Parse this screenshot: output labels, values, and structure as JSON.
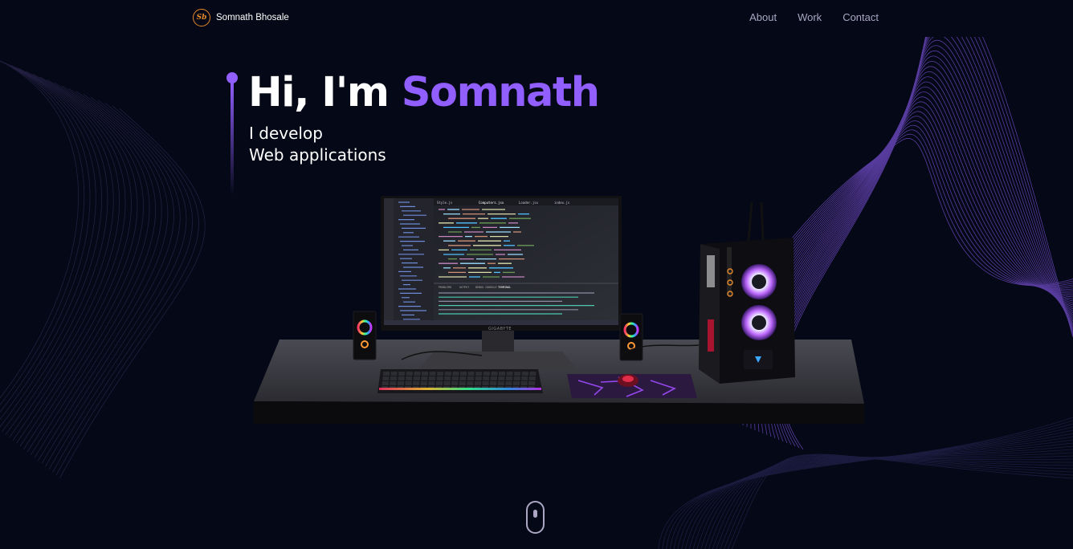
{
  "brand": {
    "name": "Somnath Bhosale",
    "logo_initials": "Sb",
    "logo_color": "#e58a2a"
  },
  "nav": {
    "links": [
      "About",
      "Work",
      "Contact"
    ]
  },
  "hero": {
    "greeting": "Hi, I'm",
    "name": "Somnath",
    "subtitle_line1": "I develop",
    "subtitle_line2": "Web applications"
  },
  "theme": {
    "background": "#050816",
    "accent": "#915eff",
    "secondary_text": "#aaa6c3"
  },
  "monitor": {
    "brand": "GIGABYTE",
    "tabs": [
      "Style.js",
      "Computers.jsx",
      "Loader.jsx",
      "index.js"
    ],
    "panel_tabs": [
      "PROBLEMS",
      "OUTPUT",
      "DEBUG CONSOLE",
      "TERMINAL"
    ]
  },
  "icons": {
    "logo": "sb-monogram-icon",
    "scroll": "mouse-scroll-icon"
  }
}
